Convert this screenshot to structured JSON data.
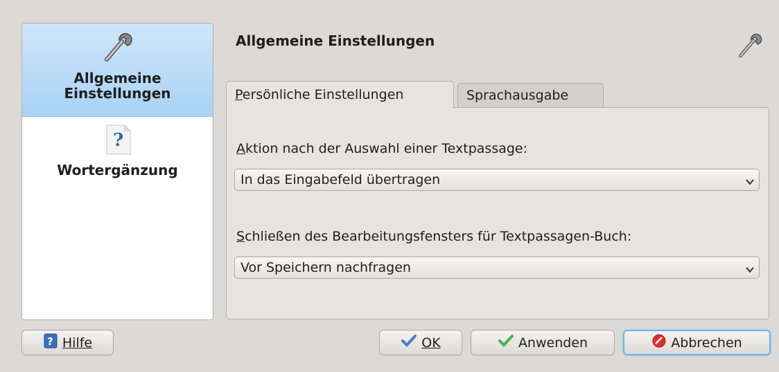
{
  "sidebar": {
    "items": [
      {
        "label": "Allgemeine Einstellungen",
        "icon": "wrench-icon",
        "selected": true
      },
      {
        "label": "Wortergänzung",
        "icon": "help-document-icon",
        "selected": false
      }
    ]
  },
  "header": {
    "title": "Allgemeine Einstellungen",
    "icon": "wrench-icon"
  },
  "tabs": [
    {
      "label": "Persönliche Einstellungen",
      "mnemonic": "P",
      "active": true
    },
    {
      "label": "Sprachausgabe",
      "mnemonic": "r",
      "active": false
    }
  ],
  "fields": {
    "action_label": "Aktion nach der Auswahl einer Textpassage:",
    "action_value": "In das Eingabefeld übertragen",
    "close_label": "Schließen des Bearbeitungsfensters für Textpassagen-Buch:",
    "close_value": "Vor Speichern nachfragen"
  },
  "buttons": {
    "help": "Hilfe",
    "ok": "OK",
    "apply": "Anwenden",
    "cancel": "Abbrechen"
  },
  "colors": {
    "selection": "#a9d2f4",
    "focus_ring": "#6fb1e8",
    "ok_check": "#4a7fc0",
    "apply_check": "#4caf50",
    "cancel_icon": "#e0302c"
  }
}
